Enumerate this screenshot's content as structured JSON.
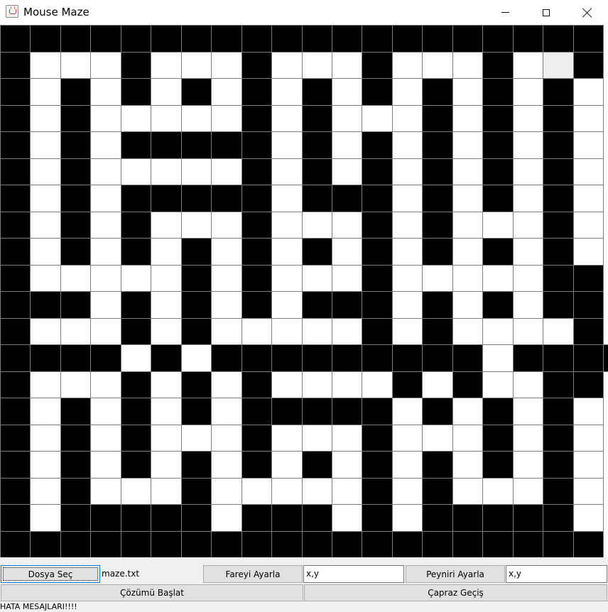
{
  "window": {
    "title": "Mouse Maze"
  },
  "maze": {
    "rows": 20,
    "cols": 20,
    "legend": {
      "#": "wall",
      ".": "open",
      "o": "highlighted"
    },
    "grid": [
      "####################",
      "#...#...#...#...#.o#",
      "#.#.#.#.#.#.#.#.#.#.",
      "#.#.....#.#...#.#.#.",
      "#.#.#####.#.#.#.#.#.",
      "#.#.....#.#.#.#.#.#.",
      "#.#.#####.###.#.#.#.",
      "#.#.#...#...#.#...#.",
      "#.#.#.#.#.#.#.#.#.#.",
      "#.....#.#...#.....##",
      "###.#.#.#.###.#.#.##",
      "#...#.#.....#.#....#",
      "####.#.#########.####",
      "#...#.#.#....#.#..##",
      "#.#.#.#.#####.#.#.#.",
      "#.#.#...#...#...#.#.",
      "#.#.#.#.#.#.#.#.#.#.",
      "#.#...#.....#.#...#.",
      "#.#####.###.#.#####.",
      "####################"
    ]
  },
  "controls": {
    "choose_file_button": "Dosya Seç",
    "file_name": "maze.txt",
    "set_mouse_button": "Fareyi Ayarla",
    "mouse_coord": {
      "value": "x,y"
    },
    "set_cheese_button": "Peyniri Ayarla",
    "cheese_coord": {
      "value": "x,y"
    },
    "start_solution_button": "Çözümü Başlat",
    "diagonal_button": "Çapraz Geçiş",
    "error_messages": "HATA MESAJLARI!!!!"
  }
}
